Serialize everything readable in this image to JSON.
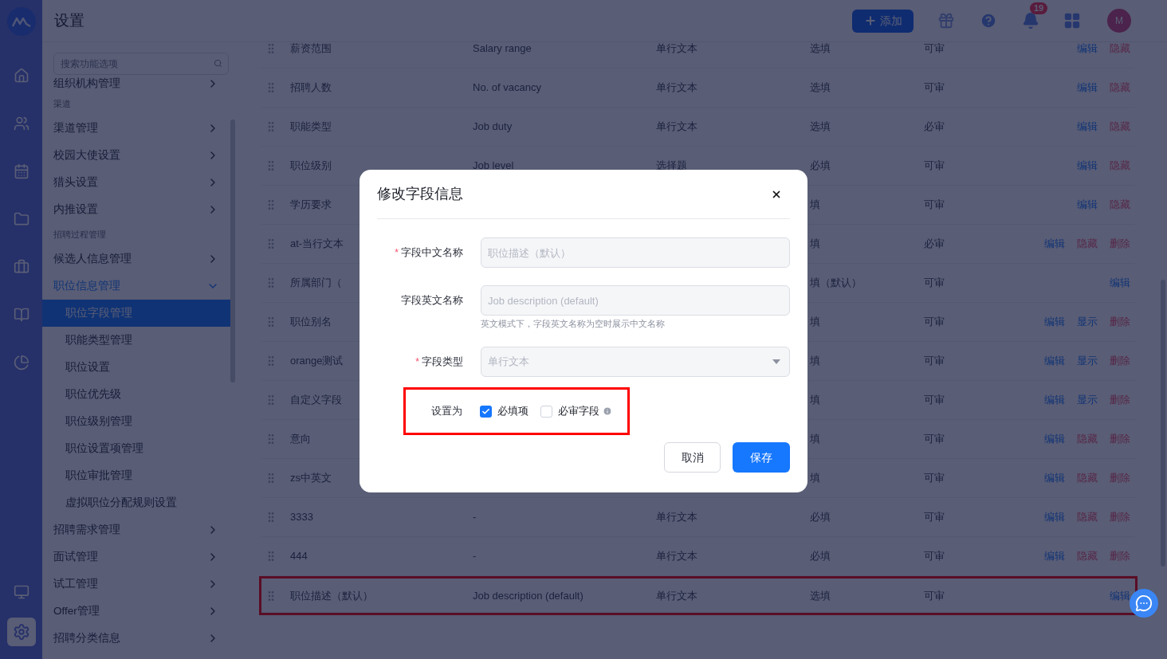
{
  "header": {
    "title": "设置",
    "add_button": "添加",
    "notification_count": "19",
    "avatar": "M"
  },
  "rail": [
    {
      "selected": false
    },
    {
      "selected": false
    },
    {
      "selected": false
    },
    {
      "selected": false
    },
    {
      "selected": false
    },
    {
      "selected": false
    },
    {
      "selected": false
    },
    {
      "selected": false
    },
    {
      "selected": true
    }
  ],
  "sidebar": {
    "search_placeholder": "搜索功能选项",
    "items": [
      {
        "kind": "item",
        "label": "组织机构管理"
      },
      {
        "kind": "group",
        "label": "渠道"
      },
      {
        "kind": "item",
        "label": "渠道管理"
      },
      {
        "kind": "item",
        "label": "校园大使设置"
      },
      {
        "kind": "item",
        "label": "猎头设置"
      },
      {
        "kind": "item",
        "label": "内推设置"
      },
      {
        "kind": "group",
        "label": "招聘过程管理"
      },
      {
        "kind": "item",
        "label": "候选人信息管理"
      },
      {
        "kind": "item",
        "label": "职位信息管理",
        "expanded": true,
        "children": [
          {
            "label": "职位字段管理",
            "selected": true
          },
          {
            "label": "职能类型管理",
            "selected": false
          },
          {
            "label": "职位设置",
            "selected": false
          },
          {
            "label": "职位优先级",
            "selected": false
          },
          {
            "label": "职位级别管理",
            "selected": false
          },
          {
            "label": "职位设置项管理",
            "selected": false
          },
          {
            "label": "职位审批管理",
            "selected": false
          },
          {
            "label": "虚拟职位分配规则设置",
            "selected": false
          }
        ]
      },
      {
        "kind": "item",
        "label": "招聘需求管理",
        "expanded": false
      },
      {
        "kind": "item",
        "label": "面试管理",
        "expanded": false
      },
      {
        "kind": "item",
        "label": "试工管理",
        "expanded": false
      },
      {
        "kind": "item",
        "label": "Offer管理",
        "expanded": false
      },
      {
        "kind": "item",
        "label": "招聘分类信息",
        "expanded": false
      }
    ]
  },
  "table": {
    "rows": [
      {
        "name": "薪资范围",
        "english": "Salary range",
        "type": "单行文本",
        "required": "选填",
        "review": "可审",
        "actions": [
          {
            "kind": "edit",
            "label": "编辑"
          },
          {
            "kind": "hide",
            "label": "隐藏"
          }
        ]
      },
      {
        "name": "招聘人数",
        "english": "No. of vacancy",
        "type": "单行文本",
        "required": "选填",
        "review": "可审",
        "actions": [
          {
            "kind": "edit",
            "label": "编辑"
          },
          {
            "kind": "hide",
            "label": "隐藏"
          }
        ]
      },
      {
        "name": "职能类型",
        "english": "Job duty",
        "type": "单行文本",
        "required": "选填",
        "review": "必审",
        "actions": [
          {
            "kind": "edit",
            "label": "编辑"
          },
          {
            "kind": "hide",
            "label": "隐藏"
          }
        ]
      },
      {
        "name": "职位级别",
        "english": "Job level",
        "type": "选择题",
        "required": "必填",
        "review": "可审",
        "actions": [
          {
            "kind": "edit",
            "label": "编辑"
          },
          {
            "kind": "hide",
            "label": "隐藏"
          }
        ]
      },
      {
        "name": "学历要求",
        "required": "填",
        "review": "可审",
        "actions": [
          {
            "kind": "edit",
            "label": "编辑"
          },
          {
            "kind": "hide",
            "label": "隐藏"
          }
        ]
      },
      {
        "name": "at-当行文本",
        "required": "填",
        "review": "必审",
        "actions": [
          {
            "kind": "edit",
            "label": "编辑"
          },
          {
            "kind": "hide",
            "label": "隐藏"
          },
          {
            "kind": "delete",
            "label": "删除"
          }
        ]
      },
      {
        "name": "所属部门（",
        "required": "填（默认）",
        "review": "可审",
        "actions": [
          {
            "kind": "edit",
            "label": "编辑"
          }
        ]
      },
      {
        "name": "职位别名",
        "required": "填",
        "review": "可审",
        "actions": [
          {
            "kind": "edit",
            "label": "编辑"
          },
          {
            "kind": "show",
            "label": "显示"
          },
          {
            "kind": "delete",
            "label": "删除"
          }
        ]
      },
      {
        "name": "orange测试",
        "required": "填",
        "review": "可审",
        "actions": [
          {
            "kind": "edit",
            "label": "编辑"
          },
          {
            "kind": "show",
            "label": "显示"
          },
          {
            "kind": "delete",
            "label": "删除"
          }
        ]
      },
      {
        "name": "自定义字段",
        "required": "填",
        "review": "可审",
        "actions": [
          {
            "kind": "edit",
            "label": "编辑"
          },
          {
            "kind": "show",
            "label": "显示"
          },
          {
            "kind": "delete",
            "label": "删除"
          }
        ]
      },
      {
        "name": "意向",
        "required": "填",
        "review": "可审",
        "actions": [
          {
            "kind": "edit",
            "label": "编辑"
          },
          {
            "kind": "hide",
            "label": "隐藏"
          },
          {
            "kind": "delete",
            "label": "删除"
          }
        ]
      },
      {
        "name": "zs中英文",
        "required": "填",
        "review": "可审",
        "actions": [
          {
            "kind": "edit",
            "label": "编辑"
          },
          {
            "kind": "hide",
            "label": "隐藏"
          },
          {
            "kind": "delete",
            "label": "删除"
          }
        ]
      },
      {
        "name": "3333",
        "english": "-",
        "type": "单行文本",
        "required": "必填",
        "review": "可审",
        "actions": [
          {
            "kind": "edit",
            "label": "编辑"
          },
          {
            "kind": "hide",
            "label": "隐藏"
          },
          {
            "kind": "delete",
            "label": "删除"
          }
        ]
      },
      {
        "name": "444",
        "english": "-",
        "type": "单行文本",
        "required": "必填",
        "review": "可审",
        "actions": [
          {
            "kind": "edit",
            "label": "编辑"
          },
          {
            "kind": "hide",
            "label": "隐藏"
          },
          {
            "kind": "delete",
            "label": "删除"
          }
        ]
      },
      {
        "name": "职位描述（默认）",
        "english": "Job description (default)",
        "type": "单行文本",
        "required": "选填",
        "review": "可审",
        "annotated": true,
        "actions": [
          {
            "kind": "edit",
            "label": "编辑"
          }
        ]
      }
    ]
  },
  "dialog": {
    "title": "修改字段信息",
    "fields": [
      {
        "kind": "input",
        "label": "字段中文名称",
        "mark": "*",
        "placeholder": "职位描述（默认）"
      },
      {
        "kind": "input",
        "label": "字段英文名称",
        "placeholder": "Job description (default)",
        "hint": "英文模式下，字段英文名称为空时展示中文名称"
      },
      {
        "kind": "select",
        "label": "字段类型",
        "mark": "*",
        "placeholder": "单行文本"
      }
    ],
    "options": {
      "label": "设置为",
      "annotated": true,
      "items": [
        {
          "label": "必填项",
          "checked": true,
          "info": false
        },
        {
          "label": "必审字段",
          "checked": false,
          "info": true
        }
      ]
    },
    "buttons": [
      {
        "kind": "secondary",
        "label": "取消"
      },
      {
        "kind": "primary",
        "label": "保存"
      }
    ]
  }
}
